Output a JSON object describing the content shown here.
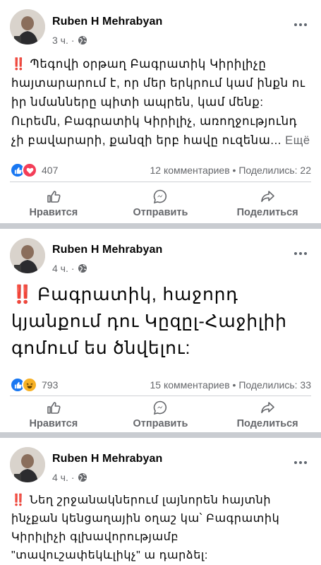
{
  "colors": {
    "accent": "#1877f2",
    "secondary_text": "#65676b",
    "alert": "#e0245e"
  },
  "actions": {
    "like": "Нравится",
    "send": "Отправить",
    "share": "Поделиться"
  },
  "posts": [
    {
      "author": "Ruben H Mehrabyan",
      "time": "3 ч.",
      "emoji": "‼️",
      "text": "Պեգովի օրթաղ Բագրատիկ Կիրիլիչը հայտարարում է, որ մեր երկրում կամ ինքն ու իր նմանները պիտի ապրեն, կամ մենք: Ուրեմն, Բագրատիկ Կիրիլիչ, առողջությունդ չի բավարարի, քանզի երբ հավը ուզենա...",
      "see_more": "Ещё",
      "reaction_count": "407",
      "reactions": [
        "like-icon",
        "love-icon"
      ],
      "comments": "12 комментариев",
      "shares": "Поделились: 22"
    },
    {
      "author": "Ruben H Mehrabyan",
      "time": "4 ч.",
      "emoji": "‼️",
      "text": "Բագրատիկ, հաջորդ կյանքում դու Կըզըլ-Հաջիլիի գոմում ես ծնվելու:",
      "reaction_count": "793",
      "reactions": [
        "like-icon",
        "haha-icon"
      ],
      "comments": "15 комментариев",
      "shares": "Поделились: 33"
    },
    {
      "author": "Ruben H Mehrabyan",
      "time": "4 ч.",
      "emoji": "‼️",
      "text": "Նեղ շրջանակներում լայնորեն հայտնի ինչքան կենցաղային օղաշ կա՝ Բագրատիկ Կիրիլիչի գլխավորությամբ \"տավուշափեկևլիկչ\" ա դարձել:"
    }
  ]
}
